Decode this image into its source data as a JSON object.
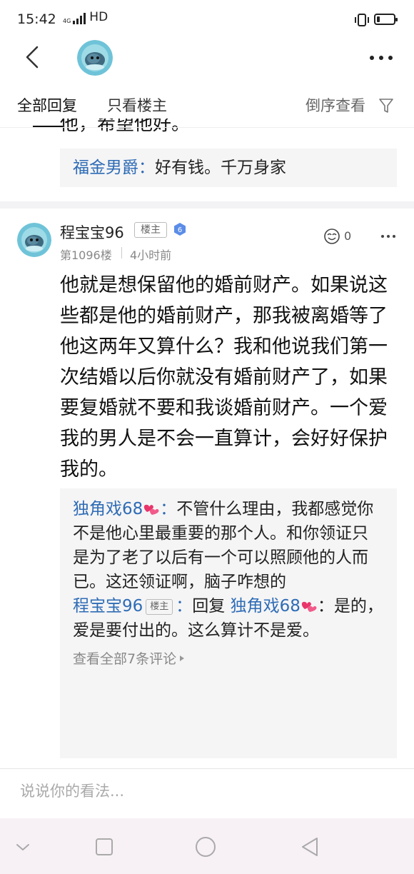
{
  "status_bar": {
    "time": "15:42",
    "network": "4G",
    "hd": "HD"
  },
  "tabs": {
    "all_replies": "全部回复",
    "owner_only": "只看楼主",
    "reverse_order": "倒序查看"
  },
  "prev_post": {
    "partial_text": "他，希望他好。",
    "sub_reply": {
      "name": "福金男爵",
      "colon": "：",
      "text": "好有钱。千万身家"
    }
  },
  "post": {
    "username": "程宝宝96",
    "badge": "楼主",
    "level": "6",
    "floor": "第1096楼",
    "time": "4小时前",
    "like_count": "0",
    "body": "他就是想保留他的婚前财产。如果说这些都是他的婚前财产，那我被离婚等了他这两年又算什么？我和他说我们第一次结婚以后你就没有婚前财产了，如果要复婚就不要和我谈婚前财产。一个爱我的男人是不会一直算计，会好好保护我的。",
    "replies": [
      {
        "name": "独角戏68",
        "colon": "：",
        "text": "不管什么理由，我都感觉你不是他心里最重要的那个人。和你领证只是为了老了以后有一个可以照顾他的人而已。这还领证啊，脑子咋想的"
      },
      {
        "name": "程宝宝96",
        "badge": "楼主",
        "colon": "：",
        "reply_word": "回复",
        "target": "独角戏68",
        "colon2": "：",
        "text": "是的，爱是要付出的。这么算计不是爱。"
      }
    ],
    "view_all": "查看全部7条评论"
  },
  "comment_box": {
    "placeholder": "说说你的看法..."
  },
  "colors": {
    "link_blue": "#2f6cb5",
    "sub_bg": "#f5f5f6",
    "nav_bg": "#f7f1f5",
    "level_blue": "#5b8de8",
    "heart_pink": "#e8356b"
  }
}
